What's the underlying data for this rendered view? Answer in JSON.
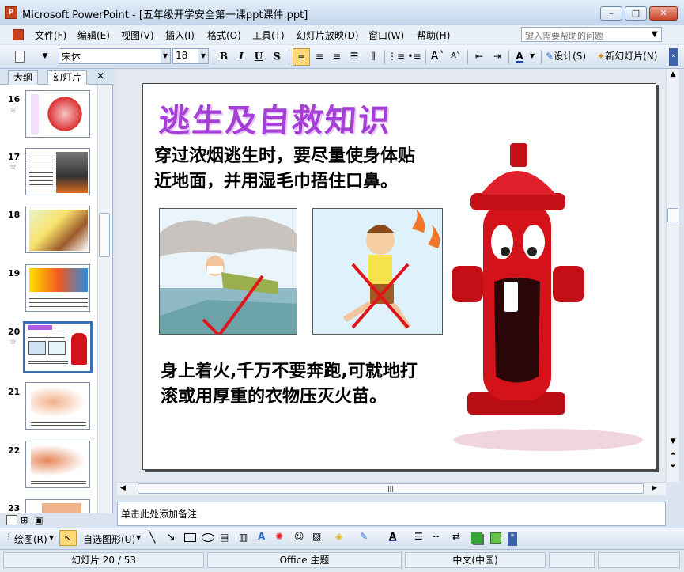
{
  "window": {
    "title": "Microsoft PowerPoint - [五年级开学安全第一课ppt课件.ppt]",
    "app_icon": "P",
    "min": "–",
    "max": "□",
    "close": "✕"
  },
  "menu": {
    "items": [
      "文件(F)",
      "编辑(E)",
      "视图(V)",
      "插入(I)",
      "格式(O)",
      "工具(T)",
      "幻灯片放映(D)",
      "窗口(W)",
      "帮助(H)"
    ],
    "help_placeholder": "键入需要帮助的问题"
  },
  "toolbar": {
    "font": "宋体",
    "size": "18",
    "bold": "B",
    "italic": "I",
    "underline": "U",
    "shadow": "S",
    "design": "设计(S)",
    "new_slide": "新幻灯片(N)"
  },
  "panel": {
    "tab_outline": "大纲",
    "tab_slides": "幻灯片",
    "close": "✕",
    "thumbs": [
      {
        "num": "16",
        "star": "☆"
      },
      {
        "num": "17",
        "star": "☆"
      },
      {
        "num": "18",
        "star": ""
      },
      {
        "num": "19",
        "star": ""
      },
      {
        "num": "20",
        "star": "☆"
      },
      {
        "num": "21",
        "star": ""
      },
      {
        "num": "22",
        "star": ""
      },
      {
        "num": "23",
        "star": ""
      }
    ],
    "selected": "20"
  },
  "slide": {
    "title": "逃生及自救知识",
    "text1_line1": "穿过浓烟逃生时，要尽量使身体贴",
    "text1_line2": "近地面，并用湿毛巾捂住口鼻。",
    "text2_line1": "身上着火,千万不要奔跑,可就地打",
    "text2_line2": "滚或用厚重的衣物压灭火苗。"
  },
  "notes": {
    "placeholder": "单击此处添加备注"
  },
  "drawbar": {
    "draw": "绘图(R)",
    "autoshapes": "自选图形(U)"
  },
  "status": {
    "slide": "幻灯片 20 / 53",
    "theme": "Office 主题",
    "lang": "中文(中国)"
  },
  "colors": {
    "title_purple": "#a53fd8",
    "hydrant_red": "#d4121a",
    "check_red": "#e0151b"
  }
}
